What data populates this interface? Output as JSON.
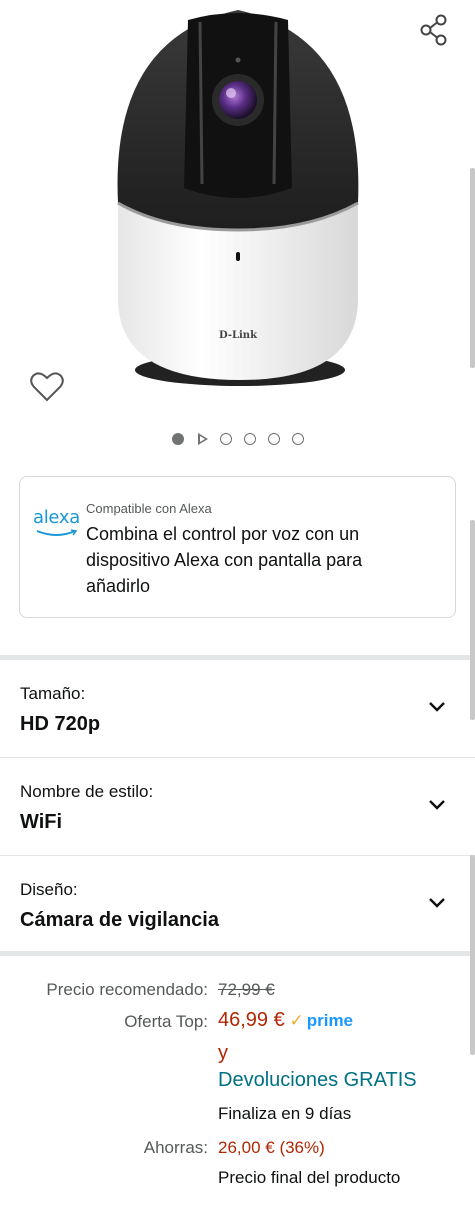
{
  "product_image": {
    "brand_text": "D-Link",
    "carousel_count": 6,
    "carousel_active_index": 0
  },
  "alexa": {
    "logo_text": "alexa",
    "small_label": "Compatible con Alexa",
    "main_text": "Combina el control por voz con un dispositivo Alexa con pantalla para añadirlo"
  },
  "variations": [
    {
      "label": "Tamaño:",
      "value": "HD 720p"
    },
    {
      "label": "Nombre de estilo:",
      "value": "WiFi"
    },
    {
      "label": "Diseño:",
      "value": "Cámara de vigilancia"
    }
  ],
  "pricing": {
    "recommended_label": "Precio recomendado:",
    "recommended_value": "72,99 €",
    "offer_label": "Oferta Top:",
    "offer_value": "46,99 €",
    "prime_label": "prime",
    "and_text": "y",
    "returns_link": "Devoluciones GRATIS",
    "ends_text": "Finaliza en 9 días",
    "savings_label": "Ahorras:",
    "savings_value": "26,00 € (36%)",
    "final_price_text": "Precio final del producto"
  },
  "colors": {
    "price_red": "#b12704",
    "link_teal": "#007185",
    "prime_blue": "#1a98ff",
    "alexa_blue": "#1a98d5"
  }
}
